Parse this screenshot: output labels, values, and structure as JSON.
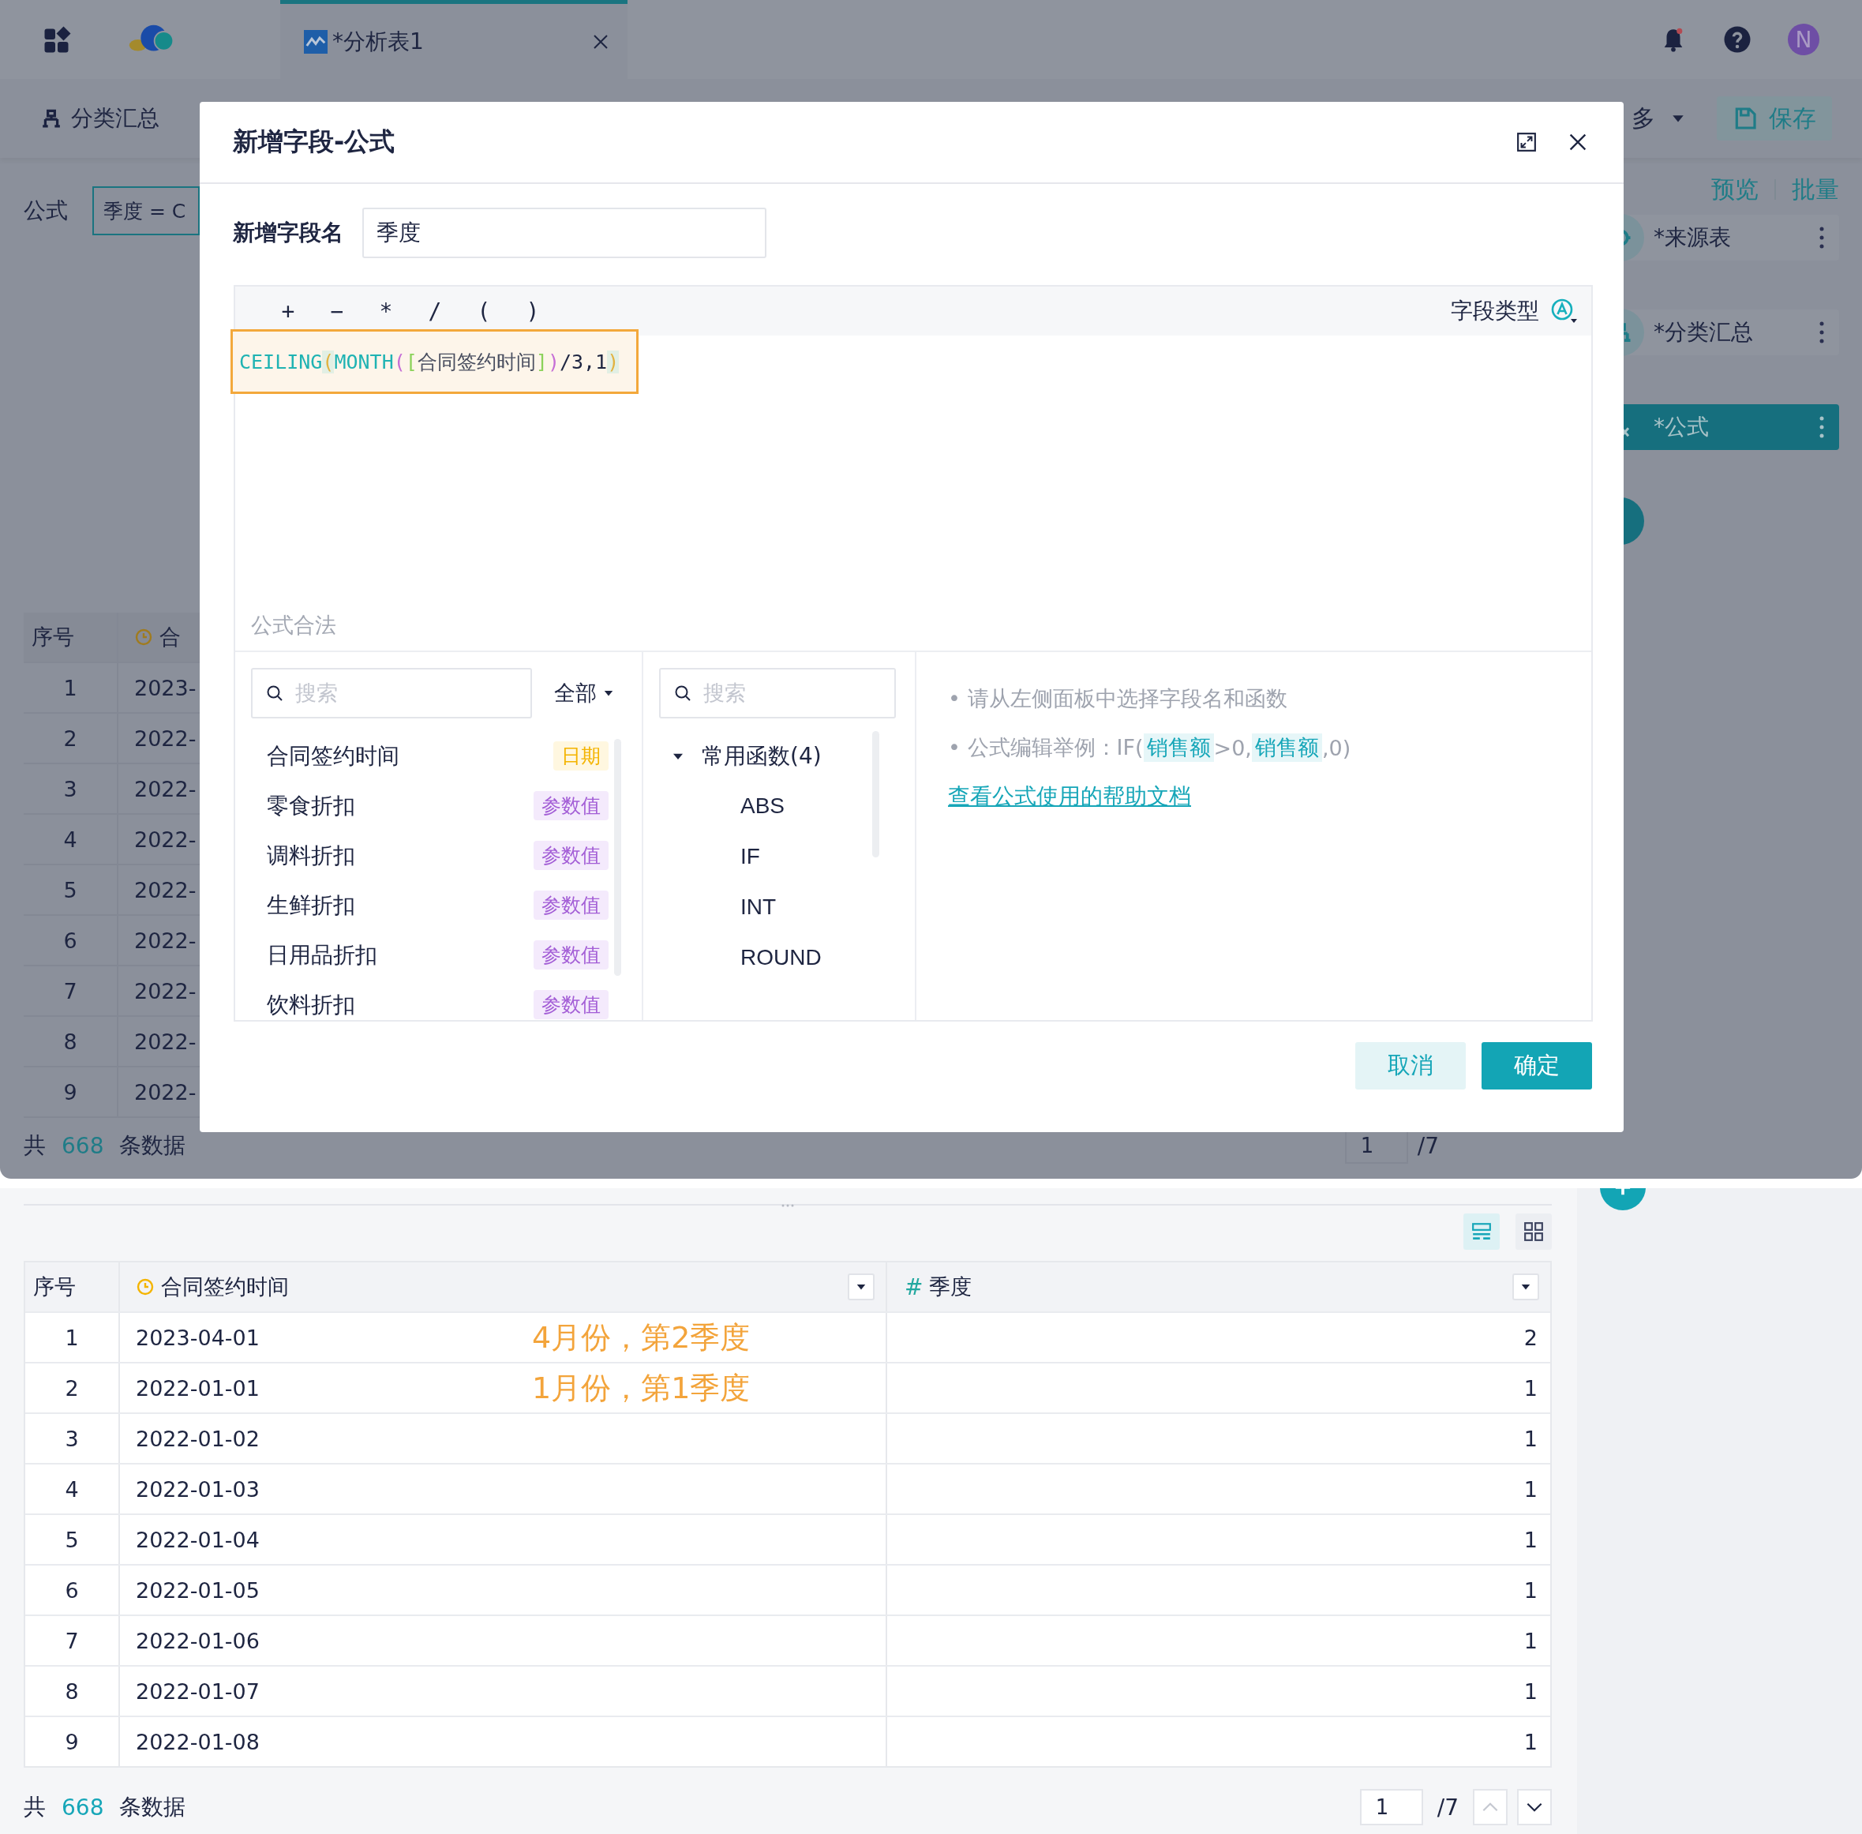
{
  "top_bar": {
    "tabs": [
      {
        "label": "*分析表1",
        "selected": true
      }
    ],
    "avatar": "N"
  },
  "toolbar": {
    "label": "分类汇总",
    "more": "多",
    "save": "保存"
  },
  "formula_bar": {
    "label": "公式",
    "value": "季度 = C"
  },
  "side_actions": [
    "预览",
    "批量"
  ],
  "flow_nodes": [
    {
      "label": "*来源表",
      "kind": "source",
      "selected": false
    },
    {
      "label": "*分类汇总",
      "kind": "group",
      "selected": false
    },
    {
      "label": "*公式",
      "kind": "formula",
      "selected": true
    }
  ],
  "background_table": {
    "columns": [
      "序号",
      "合"
    ],
    "rows": [
      [
        "1",
        "2023-"
      ],
      [
        "2",
        "2022-"
      ],
      [
        "3",
        "2022-"
      ],
      [
        "4",
        "2022-"
      ],
      [
        "5",
        "2022-"
      ],
      [
        "6",
        "2022-"
      ],
      [
        "7",
        "2022-"
      ],
      [
        "8",
        "2022-"
      ],
      [
        "9",
        "2022-"
      ]
    ]
  },
  "background_footer": {
    "prefix": "共",
    "count": "668",
    "suffix": "条数据",
    "page": "1",
    "pages": "/7"
  },
  "dialog": {
    "title": "新增字段-公式",
    "name_label": "新增字段名",
    "name_value": "季度",
    "operators": [
      "+",
      "−",
      "*",
      "/",
      "(",
      ")"
    ],
    "type_label": "字段类型",
    "formula": {
      "tokens": [
        {
          "text": "CEILING",
          "color": "#1fb3b3",
          "highlighted": false
        },
        {
          "text": "(",
          "color": "#e2b241",
          "highlighted": true
        },
        {
          "text": "MONTH",
          "color": "#1fb3b3",
          "highlighted": false
        },
        {
          "text": "(",
          "color": "#c66fd6",
          "highlighted": false
        },
        {
          "text": "[",
          "color": "#8bd25a",
          "highlighted": false
        },
        {
          "text": "合同签约时间",
          "color": "#4a4f60",
          "highlighted": false
        },
        {
          "text": "]",
          "color": "#8bd25a",
          "highlighted": false
        },
        {
          "text": ")",
          "color": "#c66fd6",
          "highlighted": false
        },
        {
          "text": "/3,1",
          "color": "#1e2541",
          "highlighted": false
        },
        {
          "text": ")",
          "color": "#e2b241",
          "highlighted": true
        }
      ]
    },
    "status": "公式合法",
    "fields": {
      "search_placeholder": "搜索",
      "filter": "全部",
      "items": [
        {
          "name": "合同签约时间",
          "type": "日期",
          "kind": "date"
        },
        {
          "name": "零食折扣",
          "type": "参数值",
          "kind": "param"
        },
        {
          "name": "调料折扣",
          "type": "参数值",
          "kind": "param"
        },
        {
          "name": "生鲜折扣",
          "type": "参数值",
          "kind": "param"
        },
        {
          "name": "日用品折扣",
          "type": "参数值",
          "kind": "param"
        },
        {
          "name": "饮料折扣",
          "type": "参数值",
          "kind": "param"
        }
      ]
    },
    "functions": {
      "search_placeholder": "搜索",
      "groups": [
        {
          "label": "常用函数(4)",
          "expanded": true,
          "children": [
            {
              "label": "ABS"
            },
            {
              "label": "IF"
            },
            {
              "label": "INT"
            },
            {
              "label": "ROUND"
            }
          ]
        }
      ]
    },
    "tips": [
      "• 请从左侧面板中选择字段名和函数",
      "• 公式编辑举例：IF(**销售额**>0,**销售额**,0)"
    ],
    "help_link": "查看公式使用的帮助文档",
    "buttons": [
      {
        "label": "取消",
        "kind": "secondary"
      },
      {
        "label": "确定",
        "kind": "primary"
      }
    ]
  },
  "result": {
    "view_toggles": [
      {
        "kind": "list",
        "selected": true
      },
      {
        "kind": "grid",
        "selected": false
      }
    ],
    "columns": [
      {
        "label": "序号",
        "kind": "index"
      },
      {
        "label": "合同签约时间",
        "kind": "date"
      },
      {
        "label": "季度",
        "kind": "number",
        "type_mark": "#"
      }
    ],
    "rows": [
      {
        "index": "1",
        "date": "2023-04-01",
        "quarter": "2",
        "note": "4月份，第2季度"
      },
      {
        "index": "2",
        "date": "2022-01-01",
        "quarter": "1",
        "note": "1月份，第1季度"
      },
      {
        "index": "3",
        "date": "2022-01-02",
        "quarter": "1"
      },
      {
        "index": "4",
        "date": "2022-01-03",
        "quarter": "1"
      },
      {
        "index": "5",
        "date": "2022-01-04",
        "quarter": "1"
      },
      {
        "index": "6",
        "date": "2022-01-05",
        "quarter": "1"
      },
      {
        "index": "7",
        "date": "2022-01-06",
        "quarter": "1"
      },
      {
        "index": "8",
        "date": "2022-01-07",
        "quarter": "1"
      },
      {
        "index": "9",
        "date": "2022-01-08",
        "quarter": "1"
      }
    ],
    "footer": {
      "prefix": "共",
      "count": "668",
      "suffix": "条数据",
      "page": "1",
      "pages": "/7"
    }
  }
}
